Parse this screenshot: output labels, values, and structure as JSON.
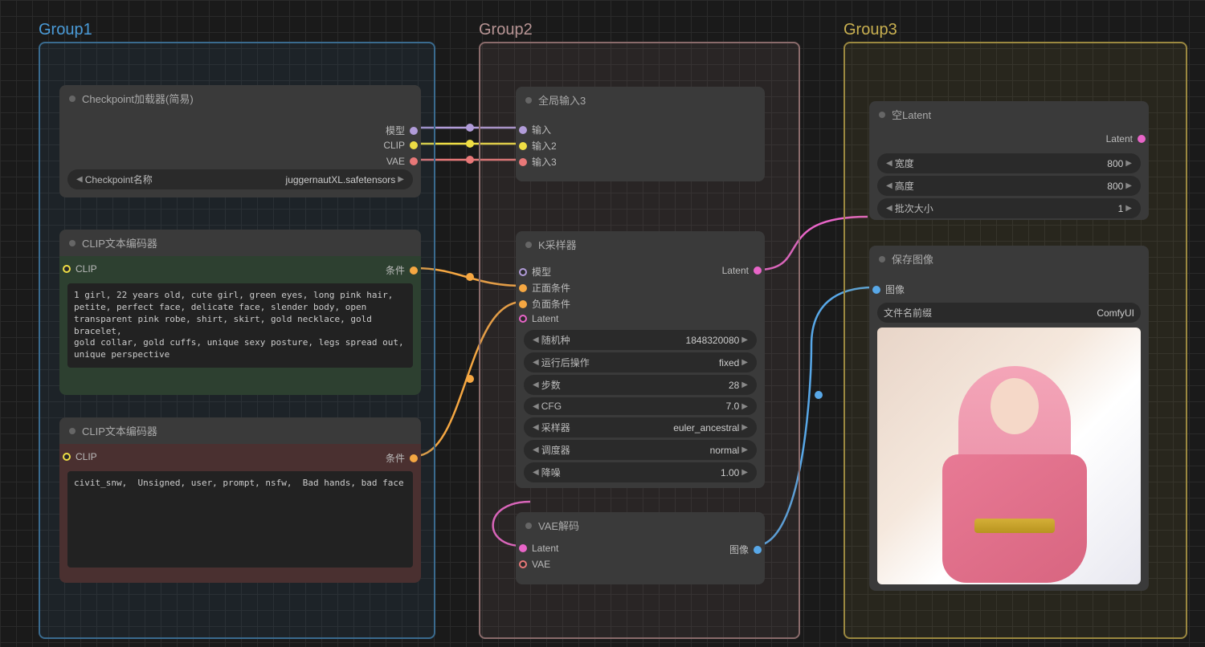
{
  "groups": {
    "g1": "Group1",
    "g2": "Group2",
    "g3": "Group3"
  },
  "checkpoint": {
    "title": "Checkpoint加载器(简易)",
    "outputs": {
      "model": "模型",
      "clip": "CLIP",
      "vae": "VAE"
    },
    "widget": {
      "label": "Checkpoint名称",
      "value": "juggernautXL.safetensors"
    }
  },
  "clipPos": {
    "title": "CLIP文本编码器",
    "input": "CLIP",
    "output": "条件",
    "text": "1 girl, 22 years old, cute girl, green eyes, long pink hair,\npetite, perfect face, delicate face, slender body, open\ntransparent pink robe, shirt, skirt, gold necklace, gold bracelet,\ngold collar, gold cuffs, unique sexy posture, legs spread out,\nunique perspective"
  },
  "clipNeg": {
    "title": "CLIP文本编码器",
    "input": "CLIP",
    "output": "条件",
    "text": "civit_snw,  Unsigned, user, prompt, nsfw,  Bad hands, bad face"
  },
  "globalInput": {
    "title": "全局输入3",
    "inputs": {
      "in1": "输入",
      "in2": "输入2",
      "in3": "输入3"
    }
  },
  "ksampler": {
    "title": "K采样器",
    "inputs": {
      "model": "模型",
      "positive": "正面条件",
      "negative": "负面条件",
      "latent": "Latent"
    },
    "output": "Latent",
    "widgets": [
      {
        "label": "随机种",
        "value": "1848320080"
      },
      {
        "label": "运行后操作",
        "value": "fixed"
      },
      {
        "label": "步数",
        "value": "28"
      },
      {
        "label": "CFG",
        "value": "7.0"
      },
      {
        "label": "采样器",
        "value": "euler_ancestral"
      },
      {
        "label": "调度器",
        "value": "normal"
      },
      {
        "label": "降噪",
        "value": "1.00"
      }
    ]
  },
  "vaeDecode": {
    "title": "VAE解码",
    "inputs": {
      "latent": "Latent",
      "vae": "VAE"
    },
    "output": "图像"
  },
  "emptyLatent": {
    "title": "空Latent",
    "output": "Latent",
    "widgets": [
      {
        "label": "宽度",
        "value": "800"
      },
      {
        "label": "高度",
        "value": "800"
      },
      {
        "label": "批次大小",
        "value": "1"
      }
    ]
  },
  "saveImage": {
    "title": "保存图像",
    "input": "图像",
    "widget": {
      "label": "文件名前缀",
      "value": "ComfyUI"
    }
  }
}
